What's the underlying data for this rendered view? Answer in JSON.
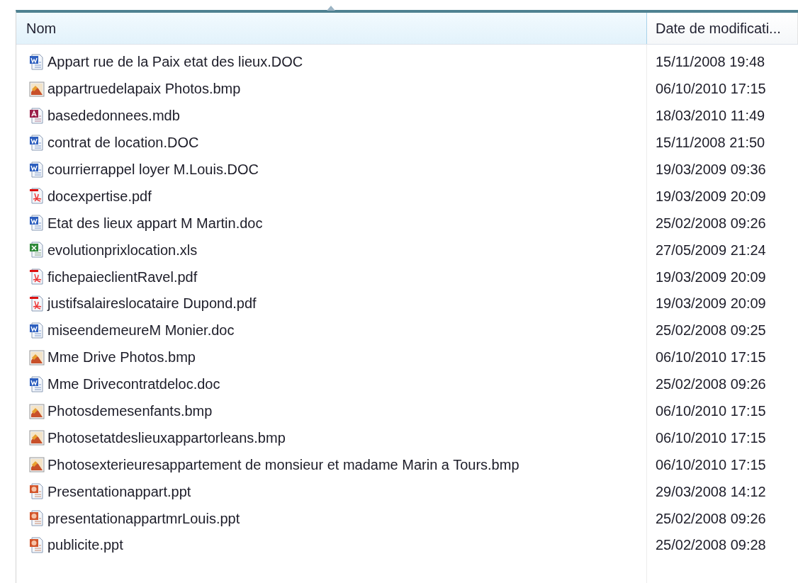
{
  "columns": [
    {
      "label": "Nom",
      "sorted": true
    },
    {
      "label": "Date de modificati...",
      "sorted": false
    }
  ],
  "files": [
    {
      "kind": "word",
      "name": "Appart rue de la Paix etat des lieux.DOC",
      "date": "15/11/2008 19:48"
    },
    {
      "kind": "image",
      "name": "appartruedelapaix Photos.bmp",
      "date": "06/10/2010 17:15"
    },
    {
      "kind": "access",
      "name": "basededonnees.mdb",
      "date": "18/03/2010 11:49"
    },
    {
      "kind": "word",
      "name": "contrat de location.DOC",
      "date": "15/11/2008 21:50"
    },
    {
      "kind": "word",
      "name": "courrierrappel loyer M.Louis.DOC",
      "date": "19/03/2009 09:36"
    },
    {
      "kind": "pdf",
      "name": "docexpertise.pdf",
      "date": "19/03/2009 20:09"
    },
    {
      "kind": "word",
      "name": "Etat des lieux appart M Martin.doc",
      "date": "25/02/2008 09:26"
    },
    {
      "kind": "excel",
      "name": "evolutionprixlocation.xls",
      "date": "27/05/2009 21:24"
    },
    {
      "kind": "pdf",
      "name": "fichepaieclientRavel.pdf",
      "date": "19/03/2009 20:09"
    },
    {
      "kind": "pdf",
      "name": "justifsalaireslocataire Dupond.pdf",
      "date": "19/03/2009 20:09"
    },
    {
      "kind": "word",
      "name": "miseendemeureM Monier.doc",
      "date": "25/02/2008 09:25"
    },
    {
      "kind": "image",
      "name": "Mme Drive Photos.bmp",
      "date": "06/10/2010 17:15"
    },
    {
      "kind": "word",
      "name": "Mme Drivecontratdeloc.doc",
      "date": "25/02/2008 09:26"
    },
    {
      "kind": "image",
      "name": "Photosdemesenfants.bmp",
      "date": "06/10/2010 17:15"
    },
    {
      "kind": "image",
      "name": "Photosetatdeslieuxappartorleans.bmp",
      "date": "06/10/2010 17:15"
    },
    {
      "kind": "image",
      "name": "Photosexterieuresappartement de monsieur et madame Marin a Tours.bmp",
      "date": "06/10/2010 17:15"
    },
    {
      "kind": "powerpoint",
      "name": "Presentationappart.ppt",
      "date": "29/03/2008 14:12"
    },
    {
      "kind": "powerpoint",
      "name": "presentationappartmrLouis.ppt",
      "date": "25/02/2008 09:26"
    },
    {
      "kind": "powerpoint",
      "name": "publicite.ppt",
      "date": "25/02/2008 09:28"
    }
  ]
}
